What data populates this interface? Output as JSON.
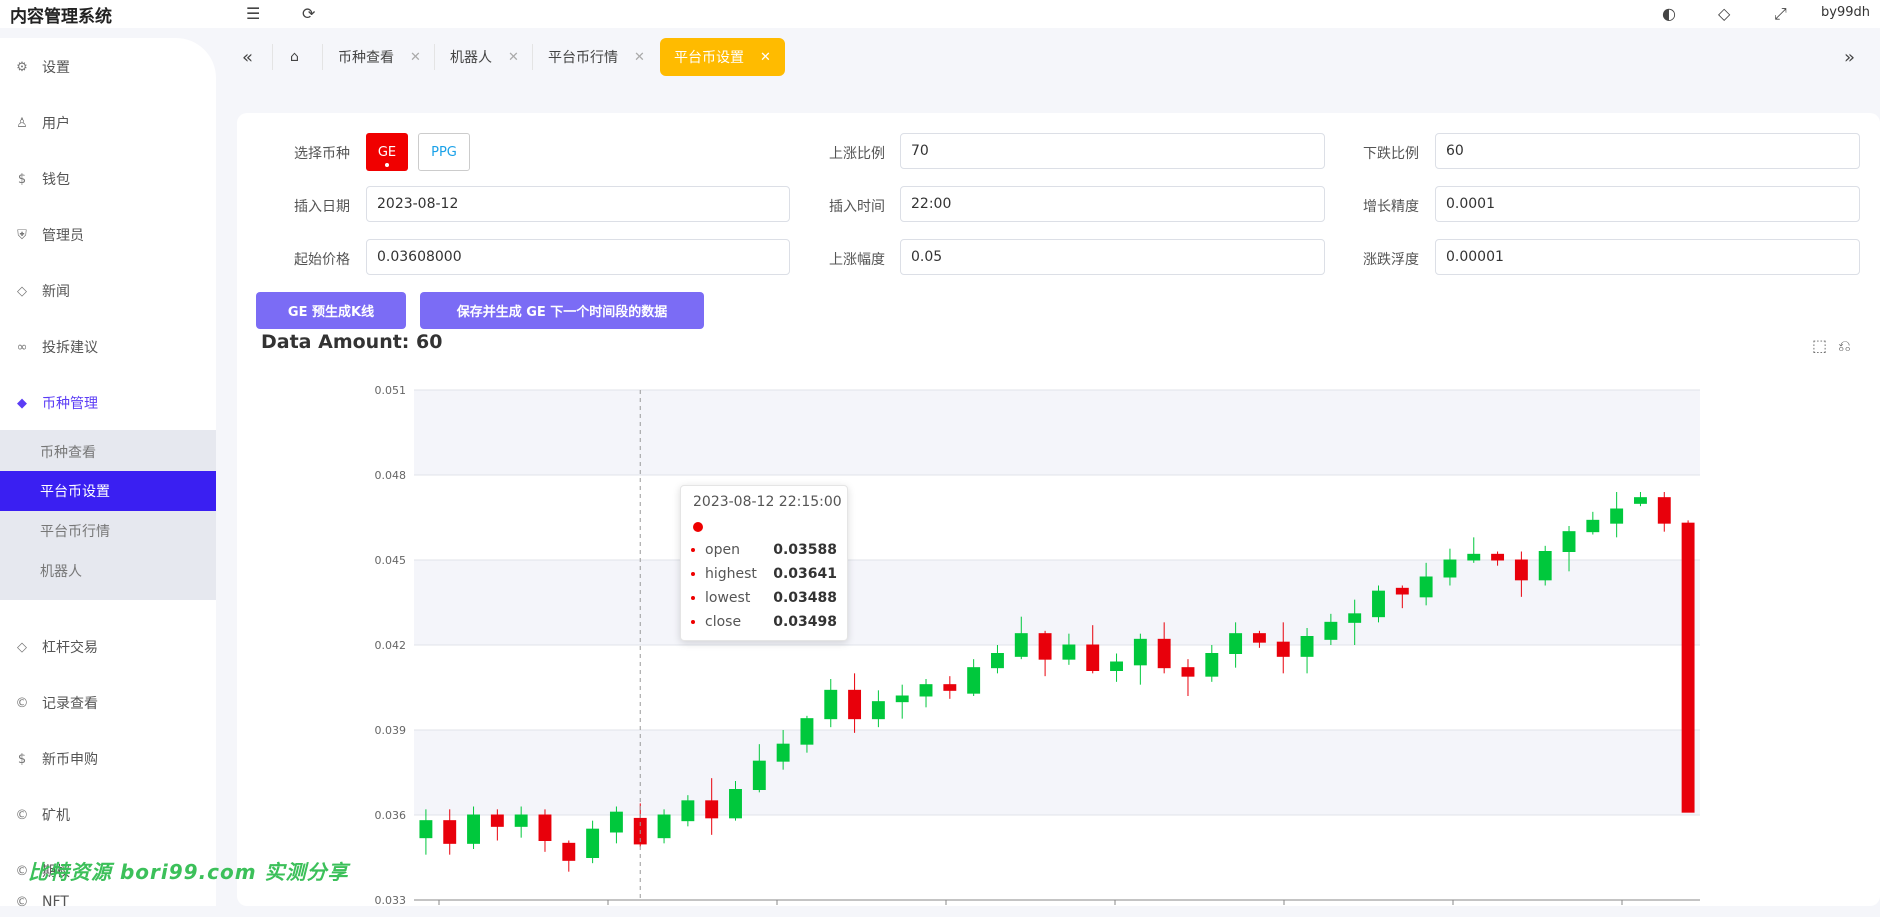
{
  "app": {
    "title": "内容管理系统",
    "user": "by99dh"
  },
  "sidebar": {
    "items": [
      {
        "label": "设置",
        "icon": "gear-icon"
      },
      {
        "label": "用户",
        "icon": "user-icon"
      },
      {
        "label": "钱包",
        "icon": "dollar-icon"
      },
      {
        "label": "管理员",
        "icon": "shield-icon"
      },
      {
        "label": "新闻",
        "icon": "tag-icon"
      },
      {
        "label": "投拆建议",
        "icon": "link-icon"
      },
      {
        "label": "币种管理",
        "icon": "diamond-icon",
        "active": true
      },
      {
        "label": "杠杆交易",
        "icon": "diamond-icon"
      },
      {
        "label": "记录查看",
        "icon": "copyright-icon"
      },
      {
        "label": "新币申购",
        "icon": "dollar-icon"
      },
      {
        "label": "矿机",
        "icon": "copyright-icon"
      },
      {
        "label": "期权",
        "icon": "copyright-icon"
      },
      {
        "label": "NFT",
        "icon": "copyright-icon"
      }
    ],
    "submenu": [
      {
        "label": "币种查看"
      },
      {
        "label": "平台币设置",
        "active": true
      },
      {
        "label": "平台币行情"
      },
      {
        "label": "机器人"
      }
    ]
  },
  "tabs": [
    {
      "label": "币种查看"
    },
    {
      "label": "机器人"
    },
    {
      "label": "平台币行情"
    },
    {
      "label": "平台币设置",
      "active": true
    }
  ],
  "form": {
    "coin_label": "选择币种",
    "coins": [
      "GE",
      "PPG"
    ],
    "rise_ratio_label": "上涨比例",
    "rise_ratio": "70",
    "fall_ratio_label": "下跌比例",
    "fall_ratio": "60",
    "insert_date_label": "插入日期",
    "insert_date": "2023-08-12",
    "insert_time_label": "插入时间",
    "insert_time": "22:00",
    "growth_precision_label": "增长精度",
    "growth_precision": "0.0001",
    "start_price_label": "起始价格",
    "start_price": "0.03608000",
    "rise_amplitude_label": "上涨幅度",
    "rise_amplitude": "0.05",
    "float_label": "涨跌浮度",
    "float_value": "0.00001"
  },
  "actions": {
    "preview_label": "GE 预生成K线",
    "save_label": "保存并生成 GE 下一个时间段的数据"
  },
  "data_amount": "Data Amount: 60",
  "tooltip": {
    "date": "2023-08-12 22:15:00",
    "open_label": "open",
    "open": "0.03588",
    "highest_label": "highest",
    "highest": "0.03641",
    "lowest_label": "lowest",
    "lowest": "0.03488",
    "close_label": "close",
    "close": "0.03498"
  },
  "watermark": "比特资源 bori99.com 实测分享",
  "colors": {
    "up": "#00c83c",
    "down": "#e8000b",
    "accent": "#3a1ff2",
    "tab_active": "#ffbb00"
  },
  "chart_data": {
    "type": "candlestick",
    "y_ticks": [
      "0.051",
      "0.048",
      "0.045",
      "0.042",
      "0.039",
      "0.036",
      "0.033"
    ],
    "ylim": [
      0.033,
      0.051
    ],
    "candles": [
      {
        "o": 0.0352,
        "c": 0.0358,
        "h": 0.0362,
        "l": 0.0346
      },
      {
        "o": 0.0358,
        "c": 0.035,
        "h": 0.0362,
        "l": 0.0346
      },
      {
        "o": 0.035,
        "c": 0.036,
        "h": 0.0363,
        "l": 0.0348
      },
      {
        "o": 0.036,
        "c": 0.0356,
        "h": 0.0362,
        "l": 0.0351
      },
      {
        "o": 0.0356,
        "c": 0.036,
        "h": 0.0363,
        "l": 0.0352
      },
      {
        "o": 0.036,
        "c": 0.0351,
        "h": 0.0362,
        "l": 0.0347
      },
      {
        "o": 0.035,
        "c": 0.0344,
        "h": 0.0351,
        "l": 0.034
      },
      {
        "o": 0.0345,
        "c": 0.0355,
        "h": 0.0358,
        "l": 0.0343
      },
      {
        "o": 0.0354,
        "c": 0.0361,
        "h": 0.0363,
        "l": 0.035
      },
      {
        "o": 0.03588,
        "c": 0.03498,
        "h": 0.03641,
        "l": 0.03488
      },
      {
        "o": 0.0352,
        "c": 0.036,
        "h": 0.0362,
        "l": 0.035
      },
      {
        "o": 0.0358,
        "c": 0.0365,
        "h": 0.0367,
        "l": 0.0356
      },
      {
        "o": 0.0365,
        "c": 0.0359,
        "h": 0.0373,
        "l": 0.0353
      },
      {
        "o": 0.0359,
        "c": 0.0369,
        "h": 0.0372,
        "l": 0.0358
      },
      {
        "o": 0.0369,
        "c": 0.0379,
        "h": 0.0385,
        "l": 0.0368
      },
      {
        "o": 0.0379,
        "c": 0.0385,
        "h": 0.039,
        "l": 0.0376
      },
      {
        "o": 0.0385,
        "c": 0.0394,
        "h": 0.0395,
        "l": 0.0382
      },
      {
        "o": 0.0394,
        "c": 0.0404,
        "h": 0.0408,
        "l": 0.0391
      },
      {
        "o": 0.0404,
        "c": 0.0394,
        "h": 0.041,
        "l": 0.0389
      },
      {
        "o": 0.0394,
        "c": 0.04,
        "h": 0.0404,
        "l": 0.0391
      },
      {
        "o": 0.04,
        "c": 0.0402,
        "h": 0.0406,
        "l": 0.0394
      },
      {
        "o": 0.0402,
        "c": 0.0406,
        "h": 0.0408,
        "l": 0.0398
      },
      {
        "o": 0.0406,
        "c": 0.0404,
        "h": 0.0409,
        "l": 0.0401
      },
      {
        "o": 0.0403,
        "c": 0.0412,
        "h": 0.0415,
        "l": 0.0402
      },
      {
        "o": 0.0412,
        "c": 0.0417,
        "h": 0.042,
        "l": 0.041
      },
      {
        "o": 0.0416,
        "c": 0.0424,
        "h": 0.043,
        "l": 0.0415
      },
      {
        "o": 0.0424,
        "c": 0.0415,
        "h": 0.0425,
        "l": 0.0409
      },
      {
        "o": 0.0415,
        "c": 0.042,
        "h": 0.0424,
        "l": 0.0413
      },
      {
        "o": 0.042,
        "c": 0.0411,
        "h": 0.0427,
        "l": 0.041
      },
      {
        "o": 0.0411,
        "c": 0.0414,
        "h": 0.0417,
        "l": 0.0407
      },
      {
        "o": 0.0413,
        "c": 0.0422,
        "h": 0.0424,
        "l": 0.0406
      },
      {
        "o": 0.0422,
        "c": 0.0412,
        "h": 0.0428,
        "l": 0.041
      },
      {
        "o": 0.0412,
        "c": 0.0409,
        "h": 0.0415,
        "l": 0.0402
      },
      {
        "o": 0.0409,
        "c": 0.0417,
        "h": 0.042,
        "l": 0.0407
      },
      {
        "o": 0.0417,
        "c": 0.0424,
        "h": 0.0428,
        "l": 0.0412
      },
      {
        "o": 0.0424,
        "c": 0.0421,
        "h": 0.0425,
        "l": 0.0419
      },
      {
        "o": 0.0421,
        "c": 0.0416,
        "h": 0.0428,
        "l": 0.041
      },
      {
        "o": 0.0416,
        "c": 0.0423,
        "h": 0.0426,
        "l": 0.041
      },
      {
        "o": 0.0422,
        "c": 0.0428,
        "h": 0.0431,
        "l": 0.042
      },
      {
        "o": 0.0428,
        "c": 0.0431,
        "h": 0.0436,
        "l": 0.042
      },
      {
        "o": 0.043,
        "c": 0.0439,
        "h": 0.0441,
        "l": 0.0428
      },
      {
        "o": 0.044,
        "c": 0.0438,
        "h": 0.0441,
        "l": 0.0433
      },
      {
        "o": 0.0437,
        "c": 0.0444,
        "h": 0.0449,
        "l": 0.0434
      },
      {
        "o": 0.0444,
        "c": 0.045,
        "h": 0.0454,
        "l": 0.0441
      },
      {
        "o": 0.045,
        "c": 0.0452,
        "h": 0.0458,
        "l": 0.0449
      },
      {
        "o": 0.0452,
        "c": 0.045,
        "h": 0.0453,
        "l": 0.0448
      },
      {
        "o": 0.045,
        "c": 0.0443,
        "h": 0.0453,
        "l": 0.0437
      },
      {
        "o": 0.0443,
        "c": 0.0453,
        "h": 0.0455,
        "l": 0.0441
      },
      {
        "o": 0.0453,
        "c": 0.046,
        "h": 0.0462,
        "l": 0.0446
      },
      {
        "o": 0.046,
        "c": 0.0464,
        "h": 0.0467,
        "l": 0.0459
      },
      {
        "o": 0.0463,
        "c": 0.0468,
        "h": 0.0474,
        "l": 0.0458
      },
      {
        "o": 0.047,
        "c": 0.0472,
        "h": 0.0474,
        "l": 0.0469
      },
      {
        "o": 0.0472,
        "c": 0.0463,
        "h": 0.0474,
        "l": 0.046
      },
      {
        "o": 0.0463,
        "c": 0.0361,
        "h": 0.0464,
        "l": 0.0361
      }
    ]
  }
}
